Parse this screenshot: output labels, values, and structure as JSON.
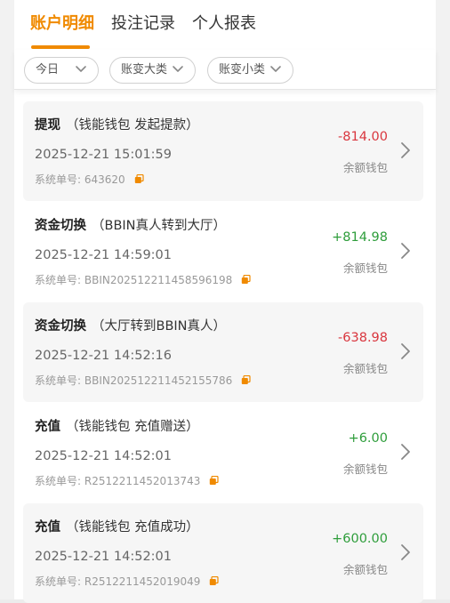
{
  "tabs": [
    {
      "label": "账户明细",
      "active": true
    },
    {
      "label": "投注记录",
      "active": false
    },
    {
      "label": "个人报表",
      "active": false
    }
  ],
  "filters": [
    {
      "label": "今日"
    },
    {
      "label": "账变大类"
    },
    {
      "label": "账变小类"
    }
  ],
  "order_prefix": "系统单号:",
  "colors": {
    "accent": "#f08a00",
    "negative": "#d9363e",
    "positive": "#2e9d3b"
  },
  "records": [
    {
      "title": "提现",
      "note": "（钱能钱包 发起提款）",
      "datetime": "2025-12-21 15:01:59",
      "order_no": "643620",
      "amount": "-814.00",
      "wallet": "余额钱包"
    },
    {
      "title": "资金切换",
      "note": "（BBIN真人转到大厅）",
      "datetime": "2025-12-21 14:59:01",
      "order_no": "BBIN202512211458596198",
      "amount": "+814.98",
      "wallet": "余额钱包"
    },
    {
      "title": "资金切换",
      "note": "（大厅转到BBIN真人）",
      "datetime": "2025-12-21 14:52:16",
      "order_no": "BBIN202512211452155786",
      "amount": "-638.98",
      "wallet": "余额钱包"
    },
    {
      "title": "充值",
      "note": "（钱能钱包 充值赠送）",
      "datetime": "2025-12-21 14:52:01",
      "order_no": "R2512211452013743",
      "amount": "+6.00",
      "wallet": "余额钱包"
    },
    {
      "title": "充值",
      "note": "（钱能钱包 充值成功）",
      "datetime": "2025-12-21 14:52:01",
      "order_no": "R2512211452019049",
      "amount": "+600.00",
      "wallet": "余额钱包"
    }
  ]
}
